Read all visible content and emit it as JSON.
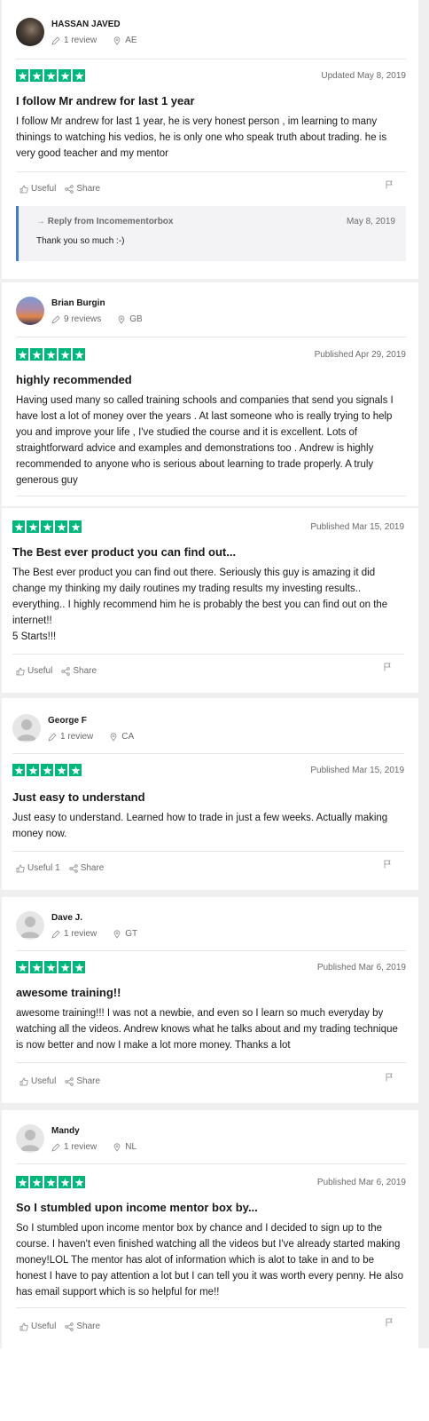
{
  "colors": {
    "star_green": "#00b67a",
    "reply_border": "#4a7ac7"
  },
  "actions": {
    "useful": "Useful",
    "share": "Share"
  },
  "reviews": [
    {
      "name": "HASSAN JAVED",
      "review_count": "1 review",
      "country": "AE",
      "avatar": "photo-dark",
      "rating": 5,
      "date": "Updated May 8, 2019",
      "title": "I follow Mr andrew for last 1 year",
      "body": "I follow Mr andrew for last 1 year, he is very honest person , im learning to many thinings to watching his vedios, he is only one who speak truth about trading. he is very good teacher and my mentor",
      "useful_label": "Useful",
      "reply": {
        "from": "Reply from Incomementorbox",
        "date": "May 8, 2019",
        "body": "Thank you so much :-)"
      }
    },
    {
      "name": "Brian Burgin",
      "review_count": "9 reviews",
      "country": "GB",
      "avatar": "photo-sunset",
      "rating": 5,
      "date": "Published Apr 29, 2019",
      "title": "highly recommended",
      "body": "Having used many so called training schools and companies that send you signals I have lost a lot of money over the years . At last someone who is really trying to help you and improve your life , I've studied the course and it is excellent. Lots of straightforward advice and examples and demonstrations too . Andrew is highly recommended to anyone who is serious about learning to trade properly. A truly generous guy"
    },
    {
      "rating": 5,
      "date": "Published Mar 15, 2019",
      "title": "The Best ever product you can find out...",
      "body": "The Best ever product you can find out there. Seriously this guy is amazing it did change my thinking my daily routines my trading results my investing results.. everything.. I highly recommend him he is probably the best you can find out on the internet!!\n5 Starts!!!",
      "useful_label": "Useful"
    },
    {
      "name": "George F",
      "review_count": "1 review",
      "country": "CA",
      "avatar": "default",
      "rating": 5,
      "date": "Published Mar 15, 2019",
      "title": "Just easy to understand",
      "body": "Just easy to understand. Learned how to trade in just a few weeks. Actually making money now.",
      "useful_label": "Useful 1"
    },
    {
      "name": "Dave J.",
      "review_count": "1 review",
      "country": "GT",
      "avatar": "default",
      "rating": 5,
      "date": "Published Mar 6, 2019",
      "title": "awesome training!!",
      "body": "awesome training!!! I was not a newbie, and even so I learn so much everyday by watching all the videos. Andrew knows what he talks about and my trading technique is now better and now I make a lot more money. Thanks a lot",
      "useful_label": "Useful"
    },
    {
      "name": "Mandy",
      "review_count": "1 review",
      "country": "NL",
      "avatar": "default",
      "rating": 5,
      "date": "Published Mar 6, 2019",
      "title": "So I stumbled upon income mentor box by...",
      "body": "So I stumbled upon income mentor box by chance and I decided to sign up to the course. I haven't even finished watching all the videos but I've already started making money!LOL The mentor has alot of information which is alot to take in and to be honest I have to pay attention a lot but I can tell you it was worth every penny. He also has email support which is so helpful for me!!",
      "useful_label": "Useful"
    }
  ]
}
